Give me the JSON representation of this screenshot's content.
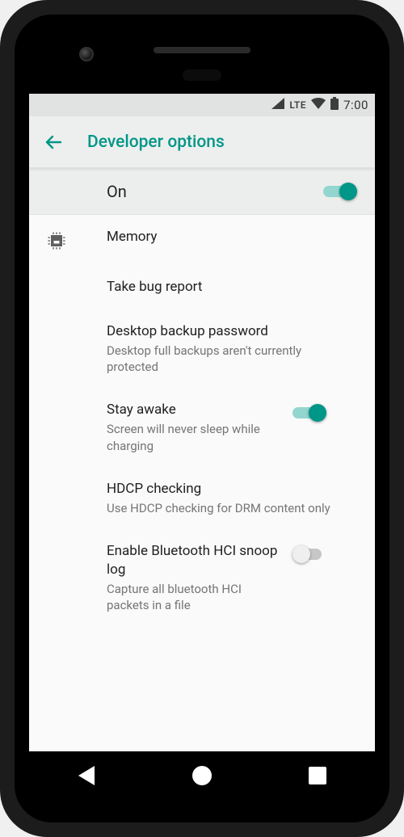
{
  "status_bar": {
    "network_label": "LTE",
    "time": "7:00"
  },
  "header": {
    "title": "Developer options"
  },
  "master": {
    "label": "On",
    "enabled": true
  },
  "items": [
    {
      "title": "Memory",
      "subtitle": null,
      "has_icon": true,
      "switch": null
    },
    {
      "title": "Take bug report",
      "subtitle": null,
      "has_icon": false,
      "switch": null
    },
    {
      "title": "Desktop backup password",
      "subtitle": "Desktop full backups aren't currently protected",
      "has_icon": false,
      "switch": null
    },
    {
      "title": "Stay awake",
      "subtitle": "Screen will never sleep while charging",
      "has_icon": false,
      "switch": true
    },
    {
      "title": "HDCP checking",
      "subtitle": "Use HDCP checking for DRM content only",
      "has_icon": false,
      "switch": null
    },
    {
      "title": "Enable Bluetooth HCI snoop log",
      "subtitle": "Capture all bluetooth HCI packets in a file",
      "has_icon": false,
      "switch": false
    }
  ],
  "colors": {
    "accent": "#009688"
  }
}
